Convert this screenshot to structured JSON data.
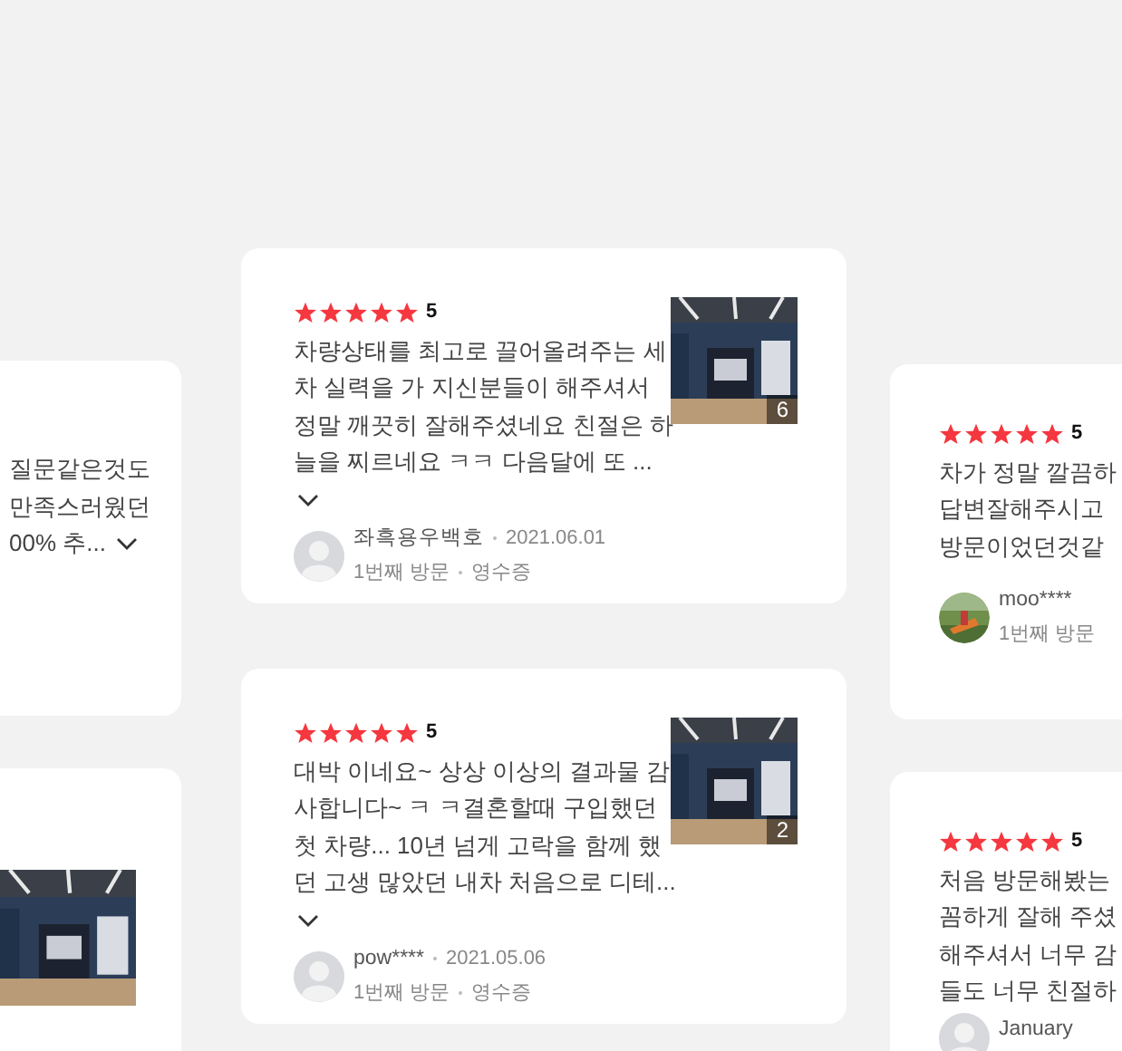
{
  "columns": [
    {
      "cards": [
        {
          "text_lines": [
            "질문같은것도",
            "만족스러웠던",
            "00% 추..."
          ],
          "more_toggle": {
            "kind": "inline"
          }
        },
        {
          "photo": {
            "kind": "picture"
          }
        }
      ]
    },
    {
      "cards": [
        {
          "stars": 5,
          "rating": "5",
          "text_lines": [
            "차량상태를 최고로 끌어올려주는 세",
            "차 실력을 가 지신분들이 해주셔서",
            "정말 깨끗히 잘해주셨네요 친절은 하",
            "늘을 찌르네요 ㅋㅋ 다음달에 또 ..."
          ],
          "more_toggle": {
            "kind": "below"
          },
          "photo": {
            "kind": "picture",
            "count": "6"
          },
          "author": {
            "avatar": {
              "kind": "default"
            },
            "name": "좌흑용우백호",
            "date": "2021.06.01",
            "visit": "1번째 방문",
            "receipt": "영수증"
          }
        },
        {
          "stars": 5,
          "rating": "5",
          "text_lines": [
            "대박 이네요~ 상상 이상의 결과물 감",
            "사합니다~ ㅋ ㅋ결혼할때 구입했던",
            "첫 차량... 10년 넘게 고락을 함께 했",
            "던 고생 많았던 내차 처음으로 디테..."
          ],
          "more_toggle": {
            "kind": "below"
          },
          "photo": {
            "kind": "picture",
            "count": "2"
          },
          "author": {
            "avatar": {
              "kind": "default"
            },
            "name": "pow****",
            "date": "2021.05.06",
            "visit": "1번째 방문",
            "receipt": "영수증"
          }
        }
      ]
    },
    {
      "cards": [
        {
          "stars": 5,
          "rating": "5",
          "text_lines": [
            "차가 정말 깔끔하",
            "답변잘해주시고",
            "방문이었던것같"
          ],
          "author": {
            "avatar": {
              "kind": "picture"
            },
            "name": "moo****",
            "visit": "1번째 방문"
          }
        },
        {
          "stars": 5,
          "rating": "5",
          "text_lines": [
            "처음 방문해봤는",
            "꼼하게 잘해 주셨",
            "해주셔서 너무 감",
            "들도 너무 친절하"
          ],
          "author": {
            "avatar": {
              "kind": "default"
            },
            "name": "January"
          }
        }
      ]
    }
  ]
}
